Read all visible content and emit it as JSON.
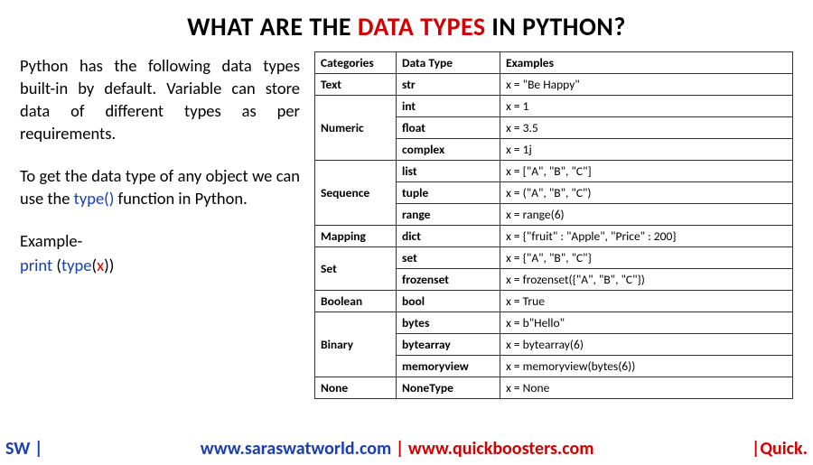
{
  "title": {
    "pre": "WHAT ARE THE ",
    "em": "DATA TYPES",
    "post": " IN PYTHON?"
  },
  "left": {
    "para1": "Python has the following data types built-in by default. Variable can store data of different types as per requirements.",
    "para2_pre": "To get the data type of any object we can use the ",
    "para2_code": "type()",
    "para2_post": " function in Python.",
    "example_label": "Example-",
    "ex_print": "print ",
    "ex_open": "(",
    "ex_type": "type",
    "ex_open2": "(",
    "ex_x": "x",
    "ex_close2": ")",
    "ex_close": ")"
  },
  "headers": {
    "c1": "Categories",
    "c2": "Data Type",
    "c3": "Examples"
  },
  "groups": [
    {
      "cat": "Text",
      "rows": [
        {
          "dt": "str",
          "ex": "x = \"Be Happy\""
        }
      ]
    },
    {
      "cat": "Numeric",
      "rows": [
        {
          "dt": "int",
          "ex": "x = 1"
        },
        {
          "dt": "float",
          "ex": "x = 3.5"
        },
        {
          "dt": "complex",
          "ex": "x = 1j"
        }
      ]
    },
    {
      "cat": "Sequence",
      "rows": [
        {
          "dt": "list",
          "ex": "x = [\"A\", \"B\", \"C\"]"
        },
        {
          "dt": "tuple",
          "ex": "x = (\"A\", \"B\", \"C\")"
        },
        {
          "dt": "range",
          "ex": "x = range(6)"
        }
      ]
    },
    {
      "cat": "Mapping",
      "rows": [
        {
          "dt": "dict",
          "ex": "x = {\"fruit\" : \"Apple\", \"Price\" : 200}"
        }
      ]
    },
    {
      "cat": "Set",
      "rows": [
        {
          "dt": "set",
          "ex": "x = {\"A\", \"B\", \"C\"}"
        },
        {
          "dt": "frozenset",
          "ex": "x = frozenset({\"A\",  \"B\", \"C\"})"
        }
      ]
    },
    {
      "cat": "Boolean",
      "rows": [
        {
          "dt": "bool",
          "ex": "x = True"
        }
      ]
    },
    {
      "cat": "Binary",
      "rows": [
        {
          "dt": "bytes",
          "ex": "x = b\"Hello\""
        },
        {
          "dt": "bytearray",
          "ex": "x = bytearray(6)"
        },
        {
          "dt": "memoryview",
          "ex": "x = memoryview(bytes(6))"
        }
      ]
    },
    {
      "cat": "None",
      "rows": [
        {
          "dt": "NoneType",
          "ex": "x = None"
        }
      ]
    }
  ],
  "footer": {
    "sw": "SW |",
    "url1": "www.saraswatworld.com",
    "sep": " | ",
    "url2": "www.quickboosters.com",
    "quick": "|Quick."
  }
}
